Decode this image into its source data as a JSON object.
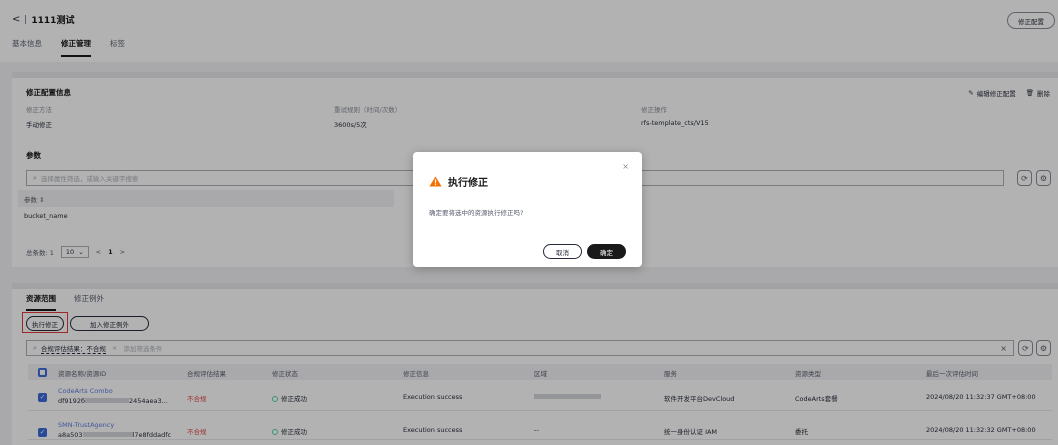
{
  "header": {
    "back": "<",
    "title": "1111测试",
    "fix_config_button": "修正配置",
    "tabs": [
      "基本信息",
      "修正管理",
      "标签"
    ],
    "active_tab": "修正管理"
  },
  "config": {
    "section_title": "修正配置信息",
    "edit_label": "编辑修正配置",
    "delete_label": "删除",
    "method_label": "修正方法",
    "method_value": "手动修正",
    "retry_label": "重试规则（时间/次数）",
    "retry_value": "3600s/5次",
    "op_label": "修正操作",
    "op_value": "rfs-template_cts/V15",
    "params_title": "参数",
    "params_search_placeholder": "选择属性筛选，或输入关键字搜索",
    "param_col_header": "参数 ⇕",
    "param_rows": [
      "bucket_name"
    ],
    "pager_total": "总条数: 1",
    "pager_size": "10",
    "pager_prev": "<",
    "pager_page": "1",
    "pager_next": ">"
  },
  "resources": {
    "tabs": [
      "资源范围",
      "修正例外"
    ],
    "active_tab": "资源范围",
    "execute_button": "执行修正",
    "add_exception_button": "加入修正例外",
    "filter_tag": "合规评估结果：不合规",
    "filter_tag_close": "×",
    "filter_placeholder": "添加筛选条件",
    "clear": "×",
    "columns": [
      "资源名称/资源ID",
      "合规评估结果",
      "修正状态",
      "修正信息",
      "区域",
      "服务",
      "资源类型",
      "最后一次评估时间"
    ],
    "rows": [
      {
        "name": "CodeArts Combo",
        "id_prefix": "df9192б",
        "id_suffix": "2454aea3...",
        "compliance": "不合规",
        "fix_status": "修正成功",
        "fix_info": "Execution success",
        "region": "",
        "service": "软件开发平台DevCloud",
        "type": "CodeArts套餐",
        "last_eval": "2024/08/20 11:32:37 GMT+08:00"
      },
      {
        "name": "SMN-TrustAgency",
        "id_prefix": "a8a503",
        "id_suffix": "l7e8fddadfc",
        "compliance": "不合规",
        "fix_status": "修正成功",
        "fix_info": "Execution success",
        "region": "--",
        "service": "统一身份认证 IAM",
        "type": "委托",
        "last_eval": "2024/08/20 11:32:32 GMT+08:00"
      }
    ]
  },
  "dialog": {
    "title": "执行修正",
    "message": "确定要将选中的资源执行修正吗?",
    "cancel": "取消",
    "confirm": "确定",
    "close": "×"
  },
  "colors": {
    "accent": "#5e7ce0",
    "danger": "#e54545",
    "success": "#50d4ab",
    "primary_button": "#191919",
    "warning": "#f66f00",
    "highlight_frame": "#e03c3c"
  }
}
